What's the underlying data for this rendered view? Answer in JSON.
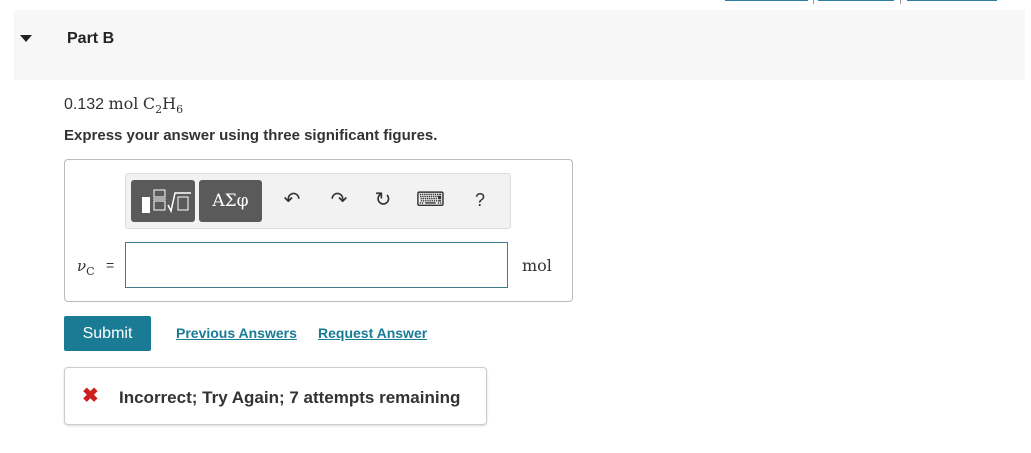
{
  "part": {
    "title": "Part B"
  },
  "given": {
    "amount": "0.132",
    "unit": "mol",
    "formula_c": "C",
    "formula_c_sub": "2",
    "formula_h": "H",
    "formula_h_sub": "6"
  },
  "instructions": "Express your answer using three significant figures.",
  "toolbar": {
    "greek_label": "ΑΣφ",
    "undo_glyph": "↶",
    "redo_glyph": "↷",
    "reset_glyph": "↻",
    "keyboard_glyph": "⌨",
    "help_label": "?"
  },
  "answer": {
    "var_symbol": "ν",
    "var_sub": "C",
    "equals": "=",
    "value": "",
    "unit": "mol"
  },
  "actions": {
    "submit_label": "Submit",
    "previous_answers_label": "Previous Answers",
    "request_answer_label": "Request Answer"
  },
  "feedback": {
    "icon": "✖",
    "message": "Incorrect; Try Again; 7 attempts remaining"
  },
  "colors": {
    "accent": "#1a7b94",
    "error": "#cc1f1f"
  }
}
